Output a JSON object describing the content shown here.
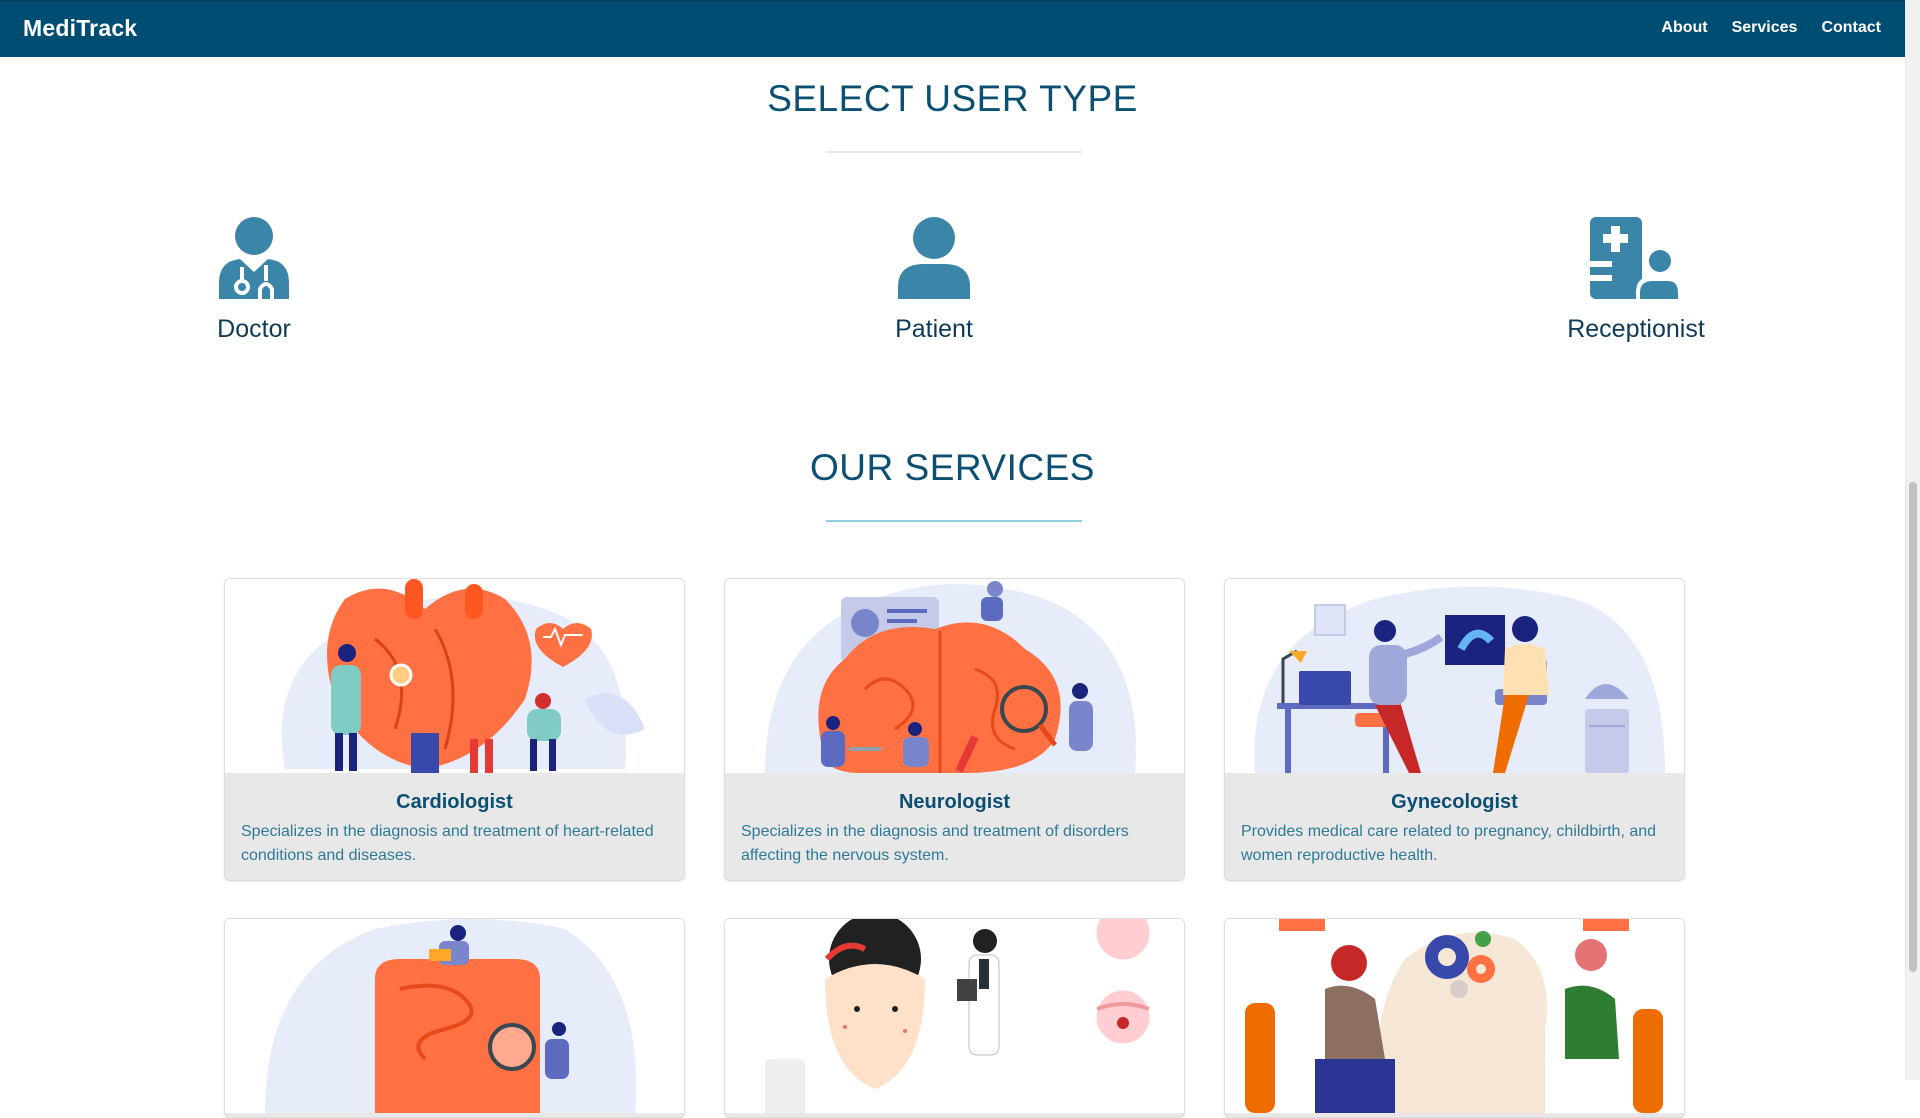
{
  "navbar": {
    "brand": "MediTrack",
    "links": [
      "About",
      "Services",
      "Contact"
    ]
  },
  "user_types": {
    "title": "SELECT USER TYPE",
    "items": [
      {
        "label": "Doctor",
        "icon": "user-doctor-icon"
      },
      {
        "label": "Patient",
        "icon": "user-icon"
      },
      {
        "label": "Receptionist",
        "icon": "hospital-user-icon"
      }
    ]
  },
  "services": {
    "title": "OUR SERVICES",
    "cards": [
      {
        "title": "Cardiologist",
        "description": "Specializes in the diagnosis and treatment of heart-related conditions and diseases.",
        "image": "heart-illustration"
      },
      {
        "title": "Neurologist",
        "description": "Specializes in the diagnosis and treatment of disorders affecting the nervous system.",
        "image": "brain-illustration"
      },
      {
        "title": "Gynecologist",
        "description": "Provides medical care related to pregnancy, childbirth, and women reproductive health.",
        "image": "consultation-illustration"
      },
      {
        "title": "",
        "description": "",
        "image": "intestine-illustration"
      },
      {
        "title": "",
        "description": "",
        "image": "skin-illustration"
      },
      {
        "title": "",
        "description": "",
        "image": "mind-illustration"
      }
    ]
  },
  "colors": {
    "navbar": "#004d73",
    "heading": "#0b4f72",
    "icon": "#3a85a8",
    "card_bg": "#e8e8e8",
    "accent_orange": "#ff7043"
  }
}
